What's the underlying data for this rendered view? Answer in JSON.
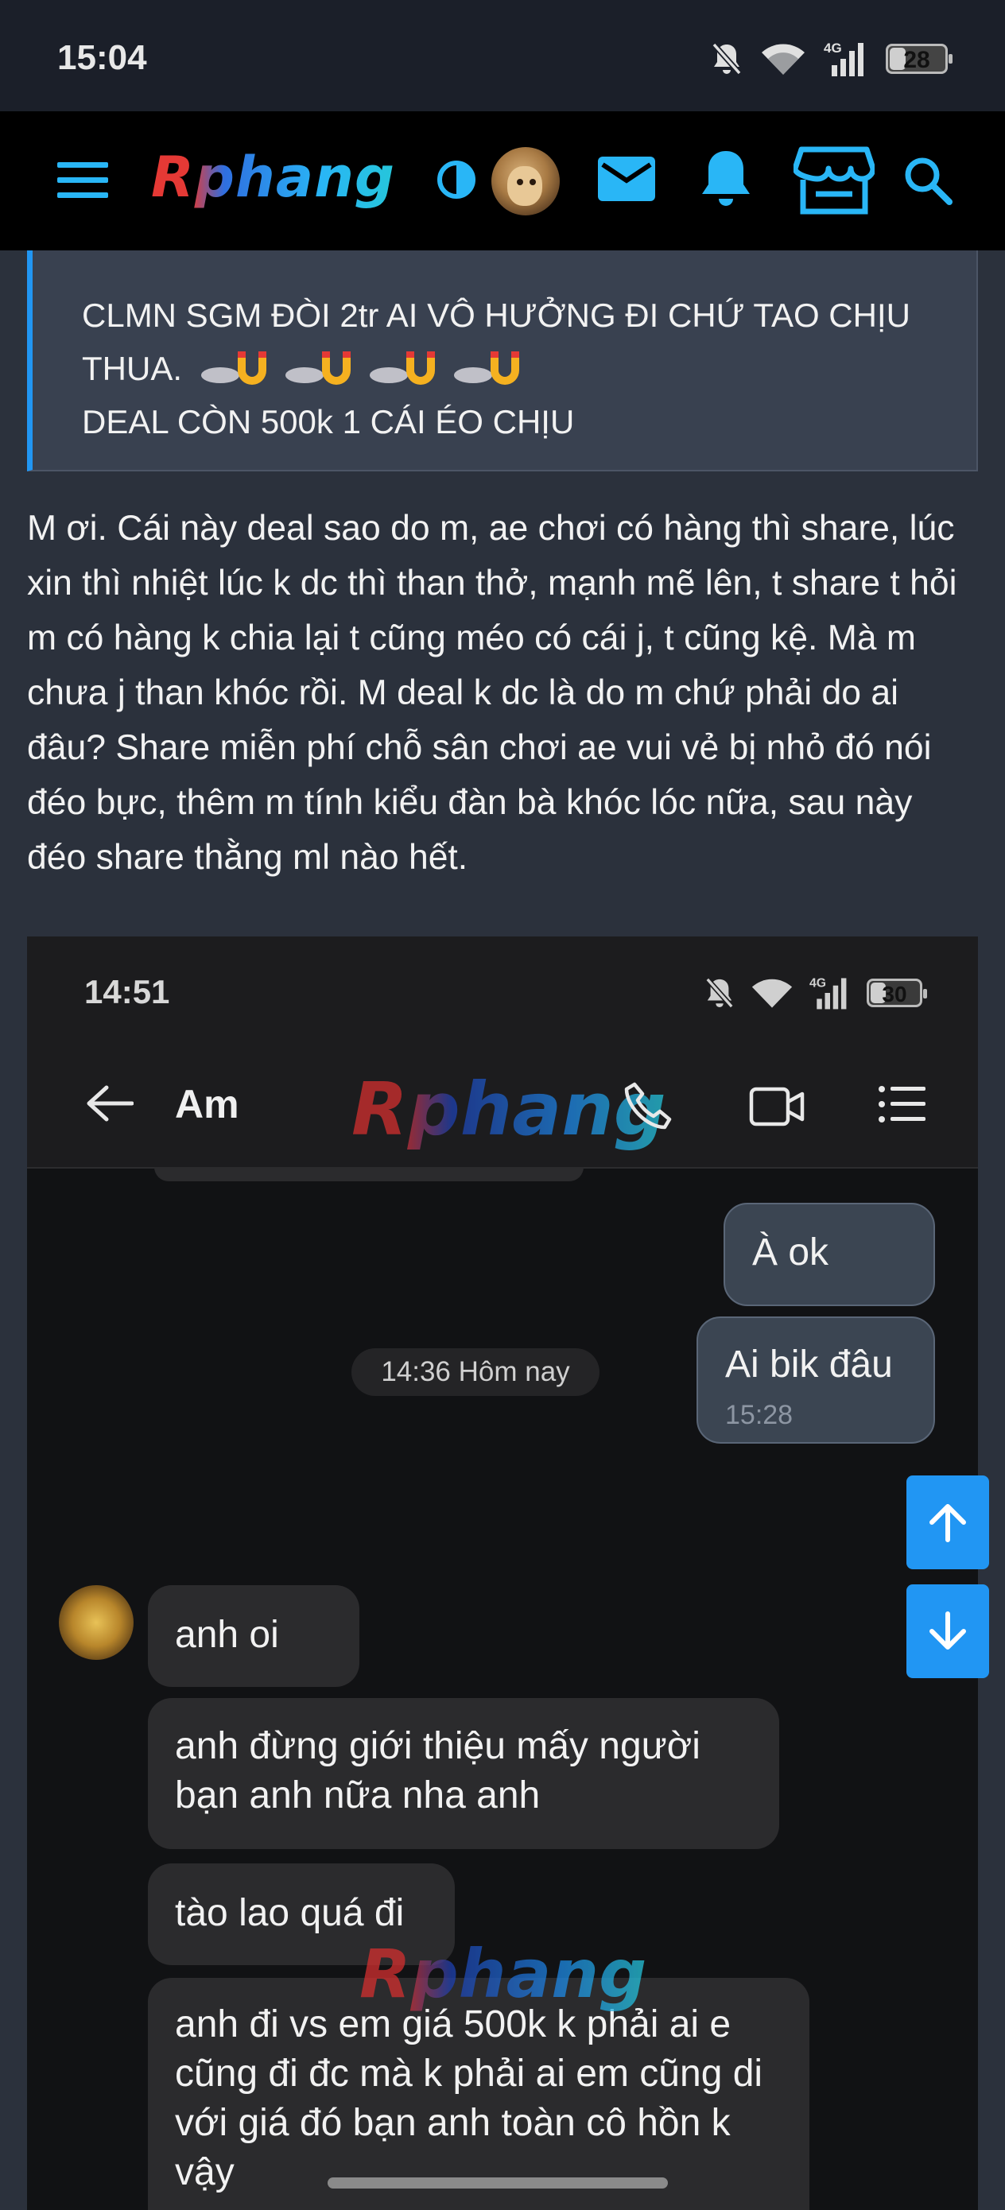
{
  "status_bar": {
    "time": "15:04",
    "battery": "28",
    "battery_level_percent": 28,
    "network": "4G"
  },
  "navbar": {
    "logo": "Rphang",
    "icons": [
      "menu-icon",
      "theme-toggle-icon",
      "avatar",
      "mail-icon",
      "bell-icon",
      "store-icon",
      "search-icon"
    ],
    "accent_color": "#2196f3"
  },
  "quote": {
    "line1": "CLMN SGM ĐÒI 2tr AI VÔ HƯỞNG ĐI CHỨ TAO CHỊU",
    "line2": "THUA.",
    "line3": "DEAL CÒN 500k 1 CÁI ÉO CHỊU",
    "emoji": "rocket-magnet-emoji"
  },
  "post": {
    "body": "M ơi. Cái này deal sao do m, ae chơi có hàng thì share, lúc xin thì nhiệt lúc k dc thì than thở, mạnh mẽ lên, t share t hỏi m có hàng k chia lại t cũng méo có cái j, t cũng kệ. Mà m chưa j than khóc rồi. M deal k dc là do m chứ phải do ai đâu? Share miễn phí chỗ sân chơi ae vui vẻ bị nhỏ đó nói đéo bực, thêm m tính kiểu đàn bà khóc lóc nữa, sau này đéo share thằng ml nào hết."
  },
  "chat_screenshot": {
    "status_time": "14:51",
    "battery": "30",
    "battery_level_percent": 30,
    "network": "4G",
    "contact_name": "Am",
    "watermark": "Rphang",
    "messages_out": [
      {
        "text": "À ok"
      },
      {
        "text": "Ai bik đâu",
        "time": "15:28"
      }
    ],
    "date_separator": "14:36 Hôm nay",
    "messages_in": [
      {
        "text": "anh oi"
      },
      {
        "text": "anh đừng giới thiệu mấy người bạn anh nữa nha anh"
      },
      {
        "text": "tào lao quá đi"
      },
      {
        "text": "anh đi vs em giá 500k k phải ai e cũng đi đc mà k phải ai em cũng di với giá đó bạn anh toàn cô hồn k vậy"
      }
    ]
  },
  "scroll_buttons": {
    "up": "arrow-up-icon",
    "down": "arrow-down-icon"
  }
}
